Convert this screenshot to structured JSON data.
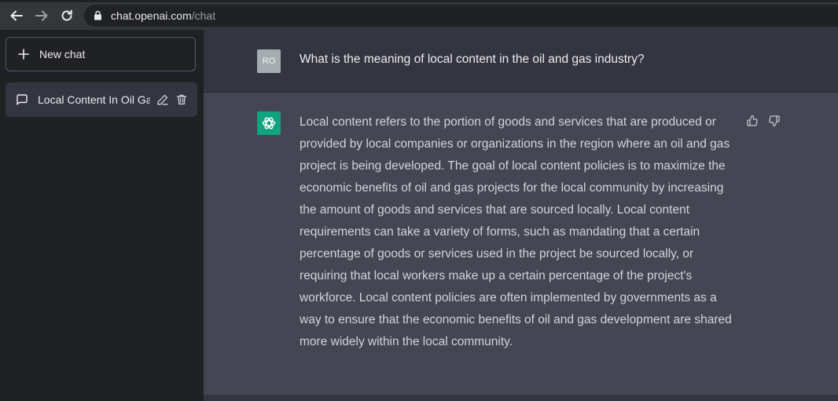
{
  "browser": {
    "url_host": "chat.openai.com",
    "url_path": "/chat"
  },
  "sidebar": {
    "new_chat_label": "New chat",
    "conversations": [
      {
        "title": "Local Content In Oil Ga"
      }
    ]
  },
  "conversation": {
    "user_initials": "RO",
    "user_message": "What is the meaning of local content in the oil and gas industry?",
    "assistant_message": "Local content refers to the portion of goods and services that are produced or provided by local companies or organizations in the region where an oil and gas project is being developed. The goal of local content policies is to maximize the economic benefits of oil and gas projects for the local community by increasing the amount of goods and services that are sourced locally. Local content requirements can take a variety of forms, such as mandating that a certain percentage of goods or services used in the project be sourced locally, or requiring that local workers make up a certain percentage of the project's workforce. Local content policies are often implemented by governments as a way to ensure that the economic benefits of oil and gas development are shared more widely within the local community."
  },
  "colors": {
    "sidebar_bg": "#202123",
    "main_bg": "#343541",
    "assistant_bg": "#444654",
    "assistant_avatar": "#10a37f",
    "user_avatar": "#a5adb0"
  },
  "icons": {
    "back": "arrow-left-icon",
    "forward": "arrow-right-icon",
    "reload": "reload-icon",
    "lock": "lock-icon",
    "new_chat": "plus-icon",
    "conversation": "message-icon",
    "edit": "pencil-icon",
    "delete": "trash-icon",
    "assistant": "openai-logo-icon",
    "like": "thumbs-up-icon",
    "dislike": "thumbs-down-icon"
  }
}
